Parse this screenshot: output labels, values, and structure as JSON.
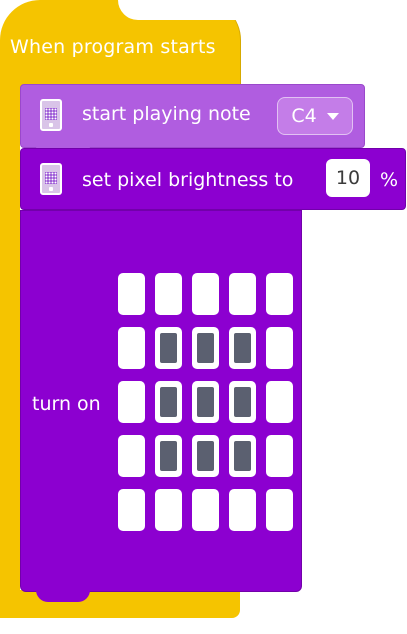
{
  "hat": {
    "title": "When program starts"
  },
  "note_block": {
    "label": "start playing note",
    "note_value": "C4",
    "icon": "hub-icon"
  },
  "brightness_block": {
    "label": "set pixel brightness to",
    "value": "10",
    "unit": "%",
    "icon": "hub-icon"
  },
  "turnon_block": {
    "label": "turn on",
    "pixels": [
      [
        0,
        0,
        0,
        0,
        0
      ],
      [
        0,
        1,
        1,
        1,
        0
      ],
      [
        0,
        1,
        1,
        1,
        0
      ],
      [
        0,
        1,
        1,
        1,
        0
      ],
      [
        0,
        0,
        0,
        0,
        0
      ]
    ]
  },
  "colors": {
    "hat": "#f5c400",
    "note_block": "#b05de0",
    "brightness_block": "#8c00d0",
    "pixel_off": "#ffffff",
    "pixel_on": "#5b6070"
  }
}
